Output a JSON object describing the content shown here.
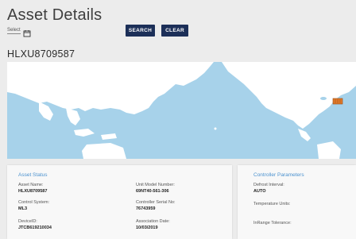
{
  "header": {
    "title": "Asset Details",
    "select_label": "Select"
  },
  "toolbar": {
    "search_label": "SEARCH",
    "clear_label": "CLEAR"
  },
  "asset": {
    "id": "HLXU8709587"
  },
  "asset_status": {
    "title": "Asset Status",
    "fields": [
      {
        "label": "Asset Name:",
        "value": "HLXU8709587"
      },
      {
        "label": "Unit Model Number:",
        "value": "69NT40-561-306"
      },
      {
        "label": "Control System:",
        "value": "ML3"
      },
      {
        "label": "Controller Serial No:",
        "value": "76743959"
      },
      {
        "label": "DeviceID:",
        "value": "JTCB619210034"
      },
      {
        "label": "Association Date:",
        "value": "10/03/2019"
      }
    ]
  },
  "controller_parameters": {
    "title": "Controller Parameters",
    "fields": [
      {
        "label": "Defrost Interval:",
        "value": "AUTO"
      },
      {
        "label": "Temperature Units:",
        "value": ""
      },
      {
        "label": "InRange Tolerance:",
        "value": ""
      }
    ]
  },
  "colors": {
    "accent": "#4c92cf",
    "button": "#1c2f58",
    "ocean": "#a7d2ea",
    "land": "#ffffff",
    "marker": "#e07a2b"
  },
  "icons": {
    "calendar": "calendar-icon",
    "marker": "container-marker-icon"
  }
}
